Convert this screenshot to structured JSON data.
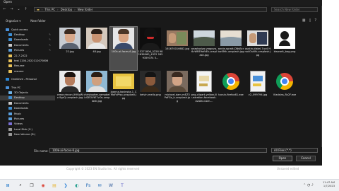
{
  "window": {
    "title": "Open"
  },
  "address": {
    "crumbs": [
      "This PC",
      "Desktop",
      "New folder"
    ],
    "search_placeholder": "Search New folder"
  },
  "toolbar": {
    "organize": "Organize ▾",
    "new_folder": "New folder"
  },
  "nav": [
    {
      "label": "Quick access",
      "icon": "star-icon",
      "color": "#4a90d9",
      "pin": "",
      "cls": ""
    },
    {
      "label": "Desktop",
      "icon": "desktop-folder-icon",
      "color": "#3d8fd6",
      "pin": "✎",
      "cls": "sub"
    },
    {
      "label": "Downloads",
      "icon": "download-folder-icon",
      "color": "#3d8fd6",
      "pin": "✎",
      "cls": "sub"
    },
    {
      "label": "Documents",
      "icon": "documents-folder-icon",
      "color": "#c9c9c9",
      "pin": "✎",
      "cls": "sub"
    },
    {
      "label": "Pictures",
      "icon": "pictures-folder-icon",
      "color": "#5aa0e0",
      "pin": "✎",
      "cls": "sub"
    },
    {
      "label": "22-7-2022",
      "icon": "folder-icon",
      "color": "#e8c25a",
      "pin": "",
      "cls": "sub"
    },
    {
      "label": "test 2204-2022112070806",
      "icon": "folder-icon",
      "color": "#e8c25a",
      "pin": "",
      "cls": "sub"
    },
    {
      "label": "Resume",
      "icon": "folder-icon",
      "color": "#e8c25a",
      "pin": "",
      "cls": "sub"
    },
    {
      "label": "resume",
      "icon": "folder-icon",
      "color": "#e8c25a",
      "pin": "",
      "cls": "sub"
    },
    {
      "label": "OneDrive - Personal",
      "icon": "cloud-icon",
      "color": "#2b88d8",
      "pin": "",
      "cls": "gap"
    },
    {
      "label": "This PC",
      "icon": "computer-icon",
      "color": "#4a90d9",
      "pin": "",
      "cls": "gap"
    },
    {
      "label": "3D Objects",
      "icon": "3d-objects-icon",
      "color": "#6fb3e8",
      "pin": "",
      "cls": "sub"
    },
    {
      "label": "Desktop",
      "icon": "desktop-folder-icon",
      "color": "#3d8fd6",
      "pin": "",
      "cls": "sub sel"
    },
    {
      "label": "Documents",
      "icon": "documents-folder-icon",
      "color": "#c9c9c9",
      "pin": "",
      "cls": "sub"
    },
    {
      "label": "Downloads",
      "icon": "download-folder-icon",
      "color": "#3d8fd6",
      "pin": "",
      "cls": "sub"
    },
    {
      "label": "Music",
      "icon": "music-folder-icon",
      "color": "#5aa0e0",
      "pin": "",
      "cls": "sub"
    },
    {
      "label": "Pictures",
      "icon": "pictures-folder-icon",
      "color": "#5aa0e0",
      "pin": "",
      "cls": "sub"
    },
    {
      "label": "Videos",
      "icon": "videos-folder-icon",
      "color": "#7a6fd6",
      "pin": "",
      "cls": "sub"
    },
    {
      "label": "Local Disk (C:)",
      "icon": "drive-icon",
      "color": "#9a9a9a",
      "pin": "",
      "cls": "sub"
    },
    {
      "label": "New Volume (D:)",
      "icon": "drive-icon",
      "color": "#9a9a9a",
      "pin": "",
      "cls": "sub"
    }
  ],
  "files": [
    {
      "name": "22.jpg",
      "kind": "portrait",
      "bg": "#c8ccd2",
      "skin": "#d9a88a",
      "hair": "#3b2a20",
      "cloth": "#5a6270",
      "sel": false
    },
    {
      "name": "48.jpg",
      "kind": "portrait",
      "bg": "#d4c8bc",
      "skin": "#c99372",
      "hair": "#2a1f18",
      "cloth": "#e8e8e8",
      "sel": false
    },
    {
      "name": "100k-ai-faces-6.jpg",
      "kind": "portrait",
      "bg": "#e6e6e6",
      "skin": "#d8a482",
      "hair": "#4a3526",
      "cloth": "#3a4a6a",
      "sel": true
    },
    {
      "name": "15271806_5228 982636960_4322 2659359374 5...",
      "kind": "hooded",
      "bg": "#0e0e0e",
      "skin": "#cc2a2a",
      "hair": "#111111",
      "cloth": "#1a1a1a",
      "sel": false
    },
    {
      "name": "161670016682.jpg",
      "kind": "photo",
      "bg": "#9a7a62",
      "skin": "#c59a78",
      "hair": "#5a4030",
      "cloth": "#7a8a5a",
      "sel": false
    },
    {
      "name": "anastasiya-vragova-6vWRE9ofkEk-unsplash.jpg",
      "kind": "landscape",
      "bg": "#7d8a93",
      "skin": "#cdd6dc",
      "hair": "#4d5a4a",
      "cloth": "#3a4a3a",
      "sel": false
    },
    {
      "name": "annie-spratt-DNsBcrbw5Mh-unsplash.jpg",
      "kind": "landscape",
      "bg": "#a8b8c4",
      "skin": "#e6ded2",
      "hair": "#8a9aa6",
      "cloth": "#6a7a5a",
      "sel": false
    },
    {
      "name": "austin-distel-7uc4 Hno4OuWk-unsplash.jpg",
      "kind": "photo",
      "bg": "#dcdcdc",
      "skin": "#c59a78",
      "hair": "#2f3a52",
      "cloth": "#2f3a52",
      "sel": false
    },
    {
      "name": "biswarit_bag.png",
      "kind": "icon",
      "bg": "#ffffff",
      "skin": "#ffffff",
      "hair": "#1a1a1a",
      "cloth": "#1a1a1a",
      "sel": false
    },
    {
      "name": "cesar-rincon-XHVpWcr5grQ-unsplash.jpg",
      "kind": "portrait",
      "bg": "#eaeaea",
      "skin": "#b57c5c",
      "hair": "#1c1410",
      "cloth": "#2a2a2a",
      "sel": false
    },
    {
      "name": "christopher-campbell-rDEOVtE7vOs-unsplash.jpg",
      "kind": "portrait",
      "bg": "#8fb9d4",
      "skin": "#d0a07e",
      "hair": "#2a1d14",
      "cloth": "#e0e0e0",
      "sel": false
    },
    {
      "name": "joanna-kosinska-1_CMoFsPfso-unsplash.jpg",
      "kind": "yellow",
      "bg": "#e8c340",
      "skin": "#f2d868",
      "hair": "#c9a020",
      "cloth": "#d6b030",
      "sel": false
    },
    {
      "name": "kelvin-mello.png",
      "kind": "portrait",
      "bg": "#2a2a2a",
      "skin": "#8a5a3c",
      "hair": "#141414",
      "cloth": "#3a2a1a",
      "sel": false
    },
    {
      "name": "michael-dam-mEZ3PoFGs_k-unsplash.jpg",
      "kind": "portrait",
      "bg": "#7a6a5e",
      "skin": "#d2a486",
      "hair": "#3a2a20",
      "cloth": "#5a4a3a",
      "sel": false
    },
    {
      "name": "png-clipart-yellow-illustration-facebook-avatar-user-...",
      "kind": "doc",
      "bg": "#f4f4f4",
      "skin": "#e8d8a8",
      "hair": "#c8a850",
      "cloth": "#d8c080",
      "sel": false
    },
    {
      "name": "tocsin-firefox61.exe",
      "kind": "chrome",
      "bg": "#191919",
      "skin": "",
      "hair": "",
      "cloth": "",
      "sel": false
    },
    {
      "name": "v2_099794.jpg",
      "kind": "doc",
      "bg": "#f2f2f2",
      "skin": "#4a90d9",
      "hair": "#e8c340",
      "cloth": "#7a7a7a",
      "sel": false
    },
    {
      "name": "Vladsins_Rz2F.exe",
      "kind": "chrome",
      "bg": "#191919",
      "skin": "",
      "hair": "",
      "cloth": "",
      "sel": false
    }
  ],
  "footer": {
    "file_name_label": "File name:",
    "file_name_value": "100k-ai-faces-6.jpg",
    "file_type": "All Files (*.*)",
    "open": "Open",
    "cancel": "Cancel"
  },
  "behind": {
    "left": "Copyright © 2023 EN Studio Inc. All rights reserved",
    "right": "Unsaved edited"
  },
  "taskbar": {
    "icons": [
      {
        "name": "windows-start-icon",
        "glyph": "⊞",
        "color": "#1a73c8"
      },
      {
        "name": "search-icon",
        "glyph": "⌕",
        "color": "#333333"
      },
      {
        "name": "task-view-icon",
        "glyph": "❐",
        "color": "#333333"
      },
      {
        "name": "chrome-icon",
        "glyph": "◉",
        "color": "#db4437"
      },
      {
        "name": "file-explorer-icon",
        "glyph": "▤",
        "color": "#e8b83a"
      },
      {
        "name": "vscode-icon",
        "glyph": "❯",
        "color": "#1f7ad6"
      },
      {
        "name": "edge-icon",
        "glyph": "◐",
        "color": "#1e9b8a"
      },
      {
        "name": "photoshop-icon",
        "glyph": "Ps",
        "color": "#2a6fb8"
      },
      {
        "name": "mail-icon",
        "glyph": "✉",
        "color": "#2a6fb8"
      },
      {
        "name": "word-icon",
        "glyph": "W",
        "color": "#2b5797"
      },
      {
        "name": "teams-icon",
        "glyph": "T",
        "color": "#5b5fc7"
      }
    ],
    "time": "11:47 AM",
    "date": "1/7/2023"
  }
}
